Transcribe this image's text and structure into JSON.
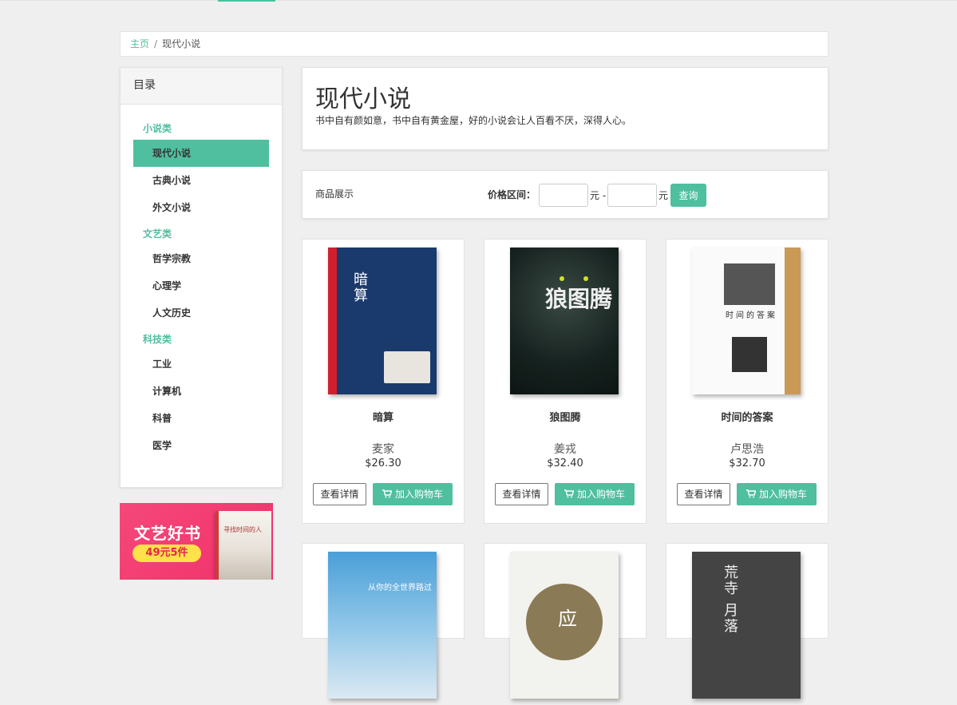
{
  "breadcrumb": {
    "home": "主页",
    "separator": "/",
    "current": "现代小说"
  },
  "sidebar": {
    "title": "目录",
    "groups": [
      {
        "label": "小说类",
        "items": [
          "现代小说",
          "古典小说",
          "外文小说"
        ]
      },
      {
        "label": "文艺类",
        "items": [
          "哲学宗教",
          "心理学",
          "人文历史"
        ]
      },
      {
        "label": "科技类",
        "items": [
          "工业",
          "计算机",
          "科普",
          "医学"
        ]
      }
    ],
    "active_item": "现代小说"
  },
  "promo": {
    "title": "文艺好书",
    "deal": "49元5件",
    "book_title": "寻找时间的人"
  },
  "header": {
    "title": "现代小说",
    "description": "书中自有颜如意，书中自有黄金屋，好的小说会让人百看不厌，深得人心。"
  },
  "filter": {
    "section_label": "商品展示",
    "price_label": "价格区间：",
    "min_value": "",
    "max_value": "",
    "unit": "元",
    "dash": "元 -",
    "query_label": "查询"
  },
  "products": [
    {
      "name": "暗算",
      "author": "麦家",
      "price": "$26.30",
      "cover_text": "暗算"
    },
    {
      "name": "狼图腾",
      "author": "姜戎",
      "price": "$32.40",
      "cover_text": "狼图腾"
    },
    {
      "name": "时间的答案",
      "author": "卢思浩",
      "price": "$32.70",
      "cover_text": "时间的答案"
    },
    {
      "cover_text": "从你的全世界路过"
    },
    {
      "cover_text": "应"
    },
    {
      "cover_text": "荒寺 月落"
    }
  ],
  "buttons": {
    "detail": "查看详情",
    "cart": "加入购物车"
  },
  "colors": {
    "accent": "#4fbf9f",
    "promo": "#f1306a",
    "promo_pill": "#ffe14a"
  }
}
